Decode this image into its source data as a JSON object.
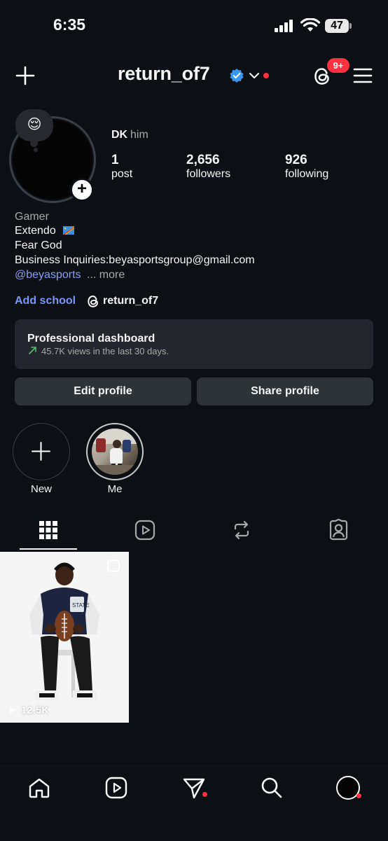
{
  "status_bar": {
    "time": "6:35",
    "battery": "47"
  },
  "header": {
    "create_icon": "plus-icon",
    "username": "return_of7",
    "verified_icon": "verified-badge-icon",
    "dropdown_icon": "chevron-down-icon",
    "threads_icon": "threads-icon",
    "notification_badge": "9+",
    "menu_icon": "hamburger-menu-icon"
  },
  "profile": {
    "note_emoji": "😌",
    "display_name": "DK",
    "pronouns": "him",
    "stats": {
      "posts": {
        "value": "1",
        "label": "post"
      },
      "followers": {
        "value": "2,656",
        "label": "followers"
      },
      "following": {
        "value": "926",
        "label": "following"
      }
    },
    "bio": {
      "category": "Gamer",
      "line1": "Extendo",
      "line2": "Fear God",
      "line3": "Business Inquiries:beyasportsgroup@gmail.com",
      "mention": "@beyasports",
      "more": "... more"
    },
    "add_school": "Add school",
    "threads_handle": "return_of7"
  },
  "dashboard": {
    "title": "Professional dashboard",
    "subtitle": "45.7K views in the last 30 days."
  },
  "buttons": {
    "edit_profile": "Edit profile",
    "share_profile": "Share profile"
  },
  "highlights": [
    {
      "label": "New"
    },
    {
      "label": "Me"
    }
  ],
  "tabs": [
    "grid-icon",
    "reels-icon",
    "reposts-icon",
    "tagged-icon"
  ],
  "posts": [
    {
      "views": "12.5K"
    }
  ],
  "bottom_nav": [
    "home-icon",
    "reels-icon",
    "messages-icon",
    "search-icon",
    "profile-avatar-icon"
  ],
  "colors": {
    "background": "#0c1014",
    "accent_blue": "#7b96f5",
    "badge_red": "#ff3040",
    "verified_blue": "#3897f0"
  }
}
